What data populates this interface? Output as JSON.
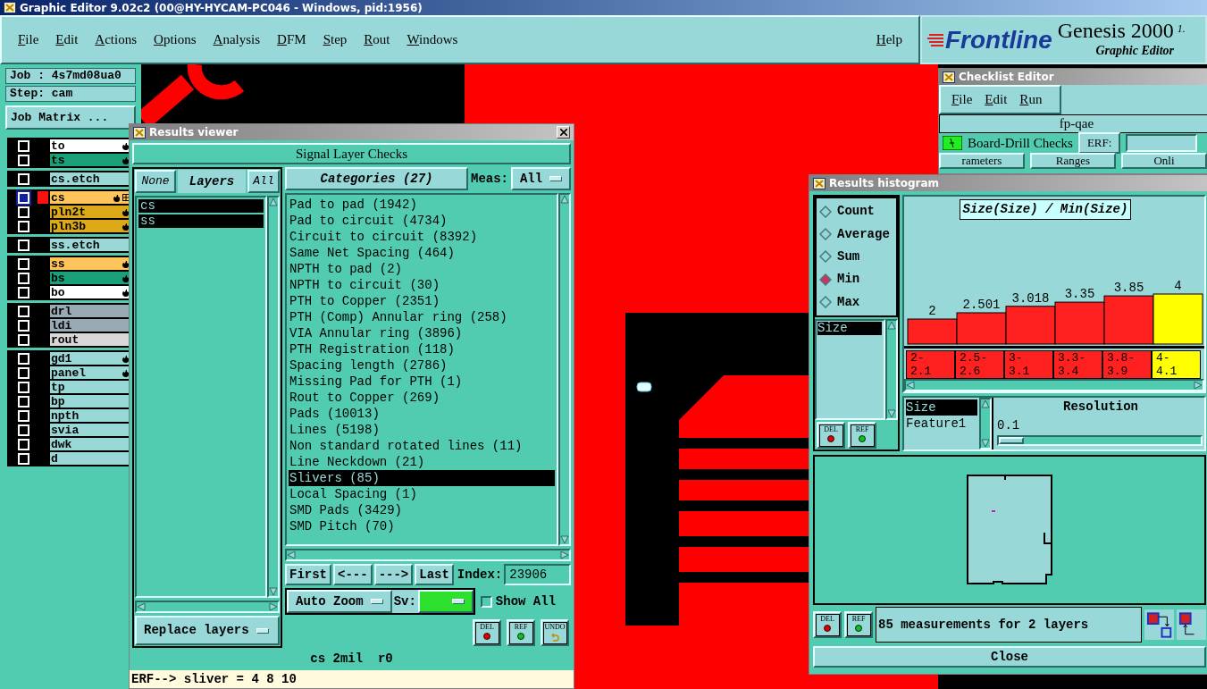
{
  "window": {
    "title": "Graphic Editor 9.02c2 (00@HY-HYCAM-PC046 - Windows, pid:1956)"
  },
  "menu": [
    "File",
    "Edit",
    "Actions",
    "Options",
    "Analysis",
    "DFM",
    "Step",
    "Rout",
    "Windows"
  ],
  "help": "Help",
  "brand": {
    "logo": "Frontline",
    "product": "Genesis 2000",
    "version": "1.",
    "subtitle": "Graphic Editor"
  },
  "job_panel": {
    "job": "Job : 4s7md08ua0",
    "step": "Step: cam",
    "matrix_button": "Job Matrix ..."
  },
  "layer_groups": [
    {
      "layers": [
        {
          "name": "to",
          "color": "#ffffff",
          "hand": true,
          "linked": false,
          "selected": false
        },
        {
          "name": "ts",
          "color": "#1aa078",
          "hand": true,
          "linked": false,
          "selected": false
        }
      ]
    },
    {
      "layers": [
        {
          "name": "cs.etch",
          "color": "#9ad8d8",
          "hand": false,
          "linked": false,
          "selected": false
        }
      ]
    },
    {
      "layers": [
        {
          "name": "cs",
          "color": "#ffc45a",
          "hand": true,
          "linked": true,
          "selected": true
        },
        {
          "name": "pln2t",
          "color": "#dcaa18",
          "hand": true,
          "linked": false,
          "selected": false
        },
        {
          "name": "pln3b",
          "color": "#dcaa18",
          "hand": true,
          "linked": false,
          "selected": false
        }
      ]
    },
    {
      "layers": [
        {
          "name": "ss.etch",
          "color": "#9ad8d8",
          "hand": false,
          "linked": false,
          "selected": false
        }
      ]
    },
    {
      "layers": [
        {
          "name": "ss",
          "color": "#ffc45a",
          "hand": true,
          "linked": false,
          "selected": false
        },
        {
          "name": "bs",
          "color": "#1aa078",
          "hand": true,
          "linked": false,
          "selected": false
        },
        {
          "name": "bo",
          "color": "#ffffff",
          "hand": true,
          "linked": false,
          "selected": false
        }
      ]
    },
    {
      "layers": [
        {
          "name": "drl",
          "color": "#98aab4",
          "hand": false,
          "linked": false,
          "selected": false
        },
        {
          "name": "ldi",
          "color": "#98aab4",
          "hand": false,
          "linked": false,
          "selected": false
        },
        {
          "name": "rout",
          "color": "#d8d8d8",
          "hand": false,
          "linked": false,
          "selected": false
        }
      ]
    },
    {
      "layers": [
        {
          "name": "gd1",
          "color": "#9ad8d8",
          "hand": true,
          "linked": false,
          "selected": false
        },
        {
          "name": "panel",
          "color": "#9ad8d8",
          "hand": true,
          "linked": false,
          "selected": false
        },
        {
          "name": "tp",
          "color": "#9ad8d8",
          "hand": false,
          "linked": false,
          "selected": false
        },
        {
          "name": "bp",
          "color": "#9ad8d8",
          "hand": false,
          "linked": false,
          "selected": false
        },
        {
          "name": "npth",
          "color": "#9ad8d8",
          "hand": false,
          "linked": false,
          "selected": false
        },
        {
          "name": "svia",
          "color": "#9ad8d8",
          "hand": false,
          "linked": false,
          "selected": false
        },
        {
          "name": "dwk",
          "color": "#9ad8d8",
          "hand": false,
          "linked": false,
          "selected": false
        },
        {
          "name": "d",
          "color": "#9ad8d8",
          "hand": false,
          "linked": false,
          "selected": false
        }
      ]
    }
  ],
  "results_viewer": {
    "title": "Results viewer",
    "header": "Signal Layer Checks",
    "none_button": "None",
    "layers_label": "Layers",
    "all_button": "All",
    "layers": [
      {
        "name": "cs",
        "selected": true
      },
      {
        "name": "ss",
        "selected": true
      }
    ],
    "categories_button": "Categories (27)",
    "meas_label": "Meas:",
    "meas_value": "All",
    "categories": [
      {
        "label": "Pad to pad (1942)",
        "selected": false
      },
      {
        "label": "Pad to circuit (4734)",
        "selected": false
      },
      {
        "label": "Circuit to circuit (8392)",
        "selected": false
      },
      {
        "label": "Same Net Spacing (464)",
        "selected": false
      },
      {
        "label": "NPTH to pad (2)",
        "selected": false
      },
      {
        "label": "NPTH to circuit (30)",
        "selected": false
      },
      {
        "label": "PTH to Copper (2351)",
        "selected": false
      },
      {
        "label": "PTH (Comp) Annular ring (258)",
        "selected": false
      },
      {
        "label": "VIA Annular ring (3896)",
        "selected": false
      },
      {
        "label": "PTH Registration (118)",
        "selected": false
      },
      {
        "label": "Spacing length (2786)",
        "selected": false
      },
      {
        "label": "Missing Pad for PTH (1)",
        "selected": false
      },
      {
        "label": "Rout to Copper (269)",
        "selected": false
      },
      {
        "label": "Pads (10013)",
        "selected": false
      },
      {
        "label": "Lines (5198)",
        "selected": false
      },
      {
        "label": "Non standard rotated lines (11)",
        "selected": false
      },
      {
        "label": "Line Neckdown (21)",
        "selected": false
      },
      {
        "label": "Slivers (85)",
        "selected": true
      },
      {
        "label": "Local Spacing (1)",
        "selected": false
      },
      {
        "label": "SMD Pads (3429)",
        "selected": false
      },
      {
        "label": "SMD Pitch (70)",
        "selected": false
      }
    ],
    "nav": [
      "First",
      "<---",
      "--->",
      "Last"
    ],
    "index_label": "Index:",
    "index_value": "23906",
    "auto_zoom": "Auto Zoom",
    "sv_label": "Sv:",
    "show_all": {
      "label": "Show All",
      "checked": false
    },
    "replace_layers": "Replace layers",
    "tools": [
      {
        "label": "DEL",
        "kind": "del"
      },
      {
        "label": "REF",
        "kind": "ref"
      },
      {
        "label": "UNDO",
        "kind": "undo"
      }
    ],
    "status": "cs 2mil  r0",
    "erf": "ERF--> sliver = 4 8 10"
  },
  "checklist_editor": {
    "title": "Checklist Editor",
    "menu": [
      "File",
      "Edit",
      "Run"
    ],
    "name": "fp-qae",
    "check": "Board-Drill Checks",
    "erf_label": "ERF:",
    "tabs": [
      "rameters",
      "Ranges",
      "Onli"
    ]
  },
  "histogram": {
    "title": "Results histogram",
    "modes": [
      {
        "label": "Count",
        "selected": false
      },
      {
        "label": "Average",
        "selected": false
      },
      {
        "label": "Sum",
        "selected": false
      },
      {
        "label": "Min",
        "selected": true
      },
      {
        "label": "Max",
        "selected": false
      }
    ],
    "fields": [
      {
        "name": "Size",
        "selected": true
      }
    ],
    "tools": [
      {
        "label": "DEL",
        "kind": "del"
      },
      {
        "label": "REF",
        "kind": "ref"
      }
    ],
    "chart_title": "Size(Size) / Min(Size)",
    "chart_data": {
      "type": "bar",
      "categories": [
        "2- 2.1",
        "2.5- 2.6",
        "3- 3.1",
        "3.3- 3.4",
        "3.8- 3.9",
        "4- 4.1"
      ],
      "values": [
        2,
        2.501,
        3.018,
        3.35,
        3.85,
        4
      ],
      "data_labels": true
    },
    "bins": [
      {
        "color": "#ff2020"
      },
      {
        "color": "#ff2020"
      },
      {
        "color": "#ff2020"
      },
      {
        "color": "#ff2020"
      },
      {
        "color": "#ff2020"
      },
      {
        "color": "#ffff00"
      }
    ],
    "sort_list": [
      {
        "label": "Size",
        "selected": true
      },
      {
        "label": "Feature1",
        "selected": false
      }
    ],
    "resolution_label": "Resolution",
    "resolution_value": "0.1",
    "resolution": {
      "level": 0.04
    },
    "status_tools": [
      {
        "label": "DEL",
        "kind": "del"
      },
      {
        "label": "REF",
        "kind": "ref"
      }
    ],
    "status": "85 measurements for 2 layers",
    "close": "Close"
  }
}
